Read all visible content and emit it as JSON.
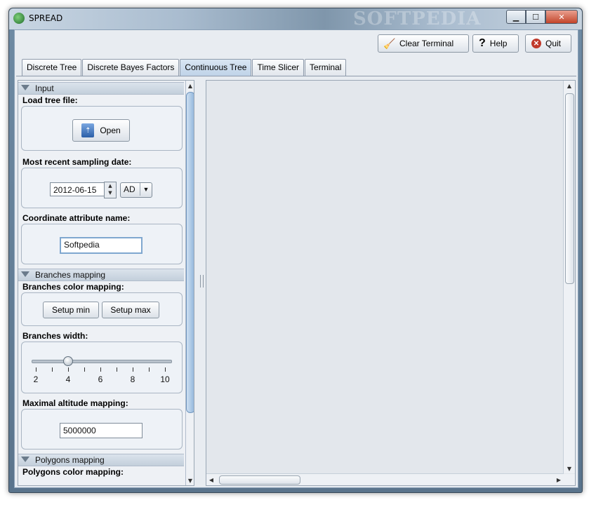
{
  "window": {
    "title": "SPREAD",
    "watermark": "SOFTPEDIA"
  },
  "toolbar": {
    "clear_label": "Clear Terminal",
    "help_label": "Help",
    "quit_label": "Quit"
  },
  "tabs": [
    "Discrete Tree",
    "Discrete Bayes Factors",
    "Continuous Tree",
    "Time Slicer",
    "Terminal"
  ],
  "active_tab": "Continuous Tree",
  "left": {
    "input_section": "Input",
    "load_tree_label": "Load tree file:",
    "open_label": "Open",
    "sampling_label": "Most recent sampling date:",
    "date_value": "2012-06-15",
    "era_value": "AD",
    "coord_label": "Coordinate attribute name:",
    "coord_value": "Softpedia",
    "branches_section": "Branches mapping",
    "branch_color_label": "Branches color mapping:",
    "setup_min_label": "Setup min",
    "setup_max_label": "Setup max",
    "branch_width_label": "Branches width:",
    "width_ticks": [
      "2",
      "4",
      "6",
      "8",
      "10"
    ],
    "width_value": 4,
    "altitude_label": "Maximal altitude mapping:",
    "altitude_value": "5000000",
    "polygons_section": "Polygons mapping",
    "polygons_color_label": "Polygons color mapping:"
  },
  "icons": {
    "clear": "broom-icon",
    "help": "question-icon",
    "quit": "close-circle-icon",
    "open": "folder-open-icon",
    "collapse": "triangle-down-icon"
  },
  "colors": {
    "active_tab": "#bfd3e8",
    "scroll_thumb": "#8fb4da",
    "quit": "#c0392b"
  }
}
